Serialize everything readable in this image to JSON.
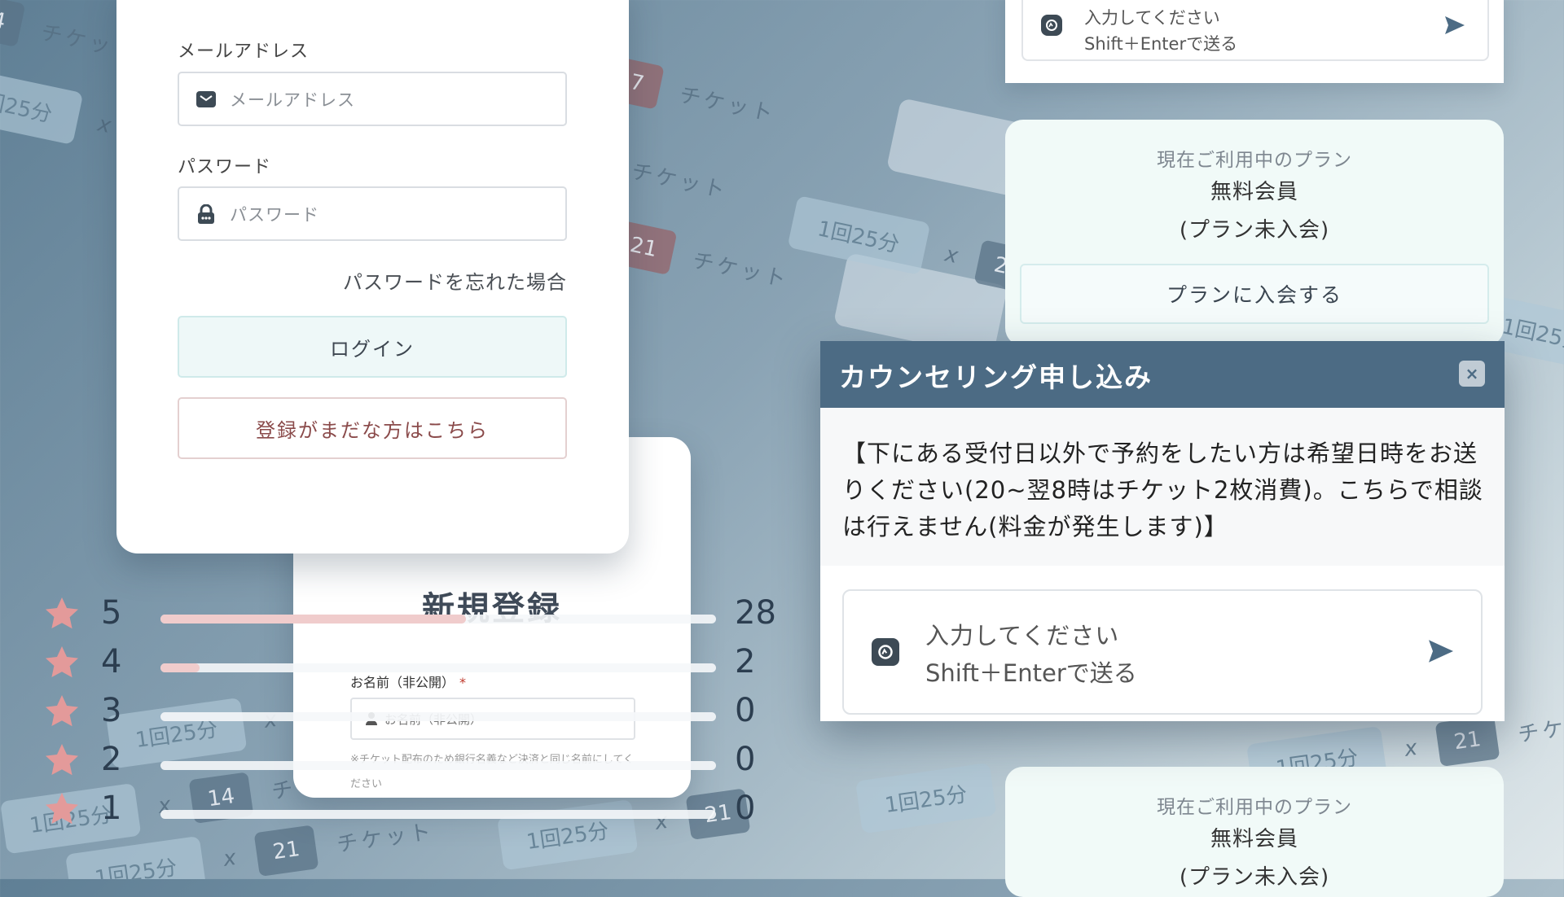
{
  "login": {
    "email_label": "メールアドレス",
    "email_placeholder": "メールアドレス",
    "password_label": "パスワード",
    "password_placeholder": "パスワード",
    "forgot_link": "パスワードを忘れた場合",
    "login_button": "ログイン",
    "register_button": "登録がまだな方はこちら"
  },
  "signup": {
    "title": "新規登録",
    "name_label": "お名前（非公開）",
    "required_mark": "*",
    "name_placeholder": "お名前（非公開）",
    "name_note": "※チケット配布のため銀行名義など決済と同じ名前にしてください"
  },
  "ratings": [
    {
      "stars": "5",
      "count": "28",
      "fill": 0.55
    },
    {
      "stars": "4",
      "count": "2",
      "fill": 0.07
    },
    {
      "stars": "3",
      "count": "0",
      "fill": 0
    },
    {
      "stars": "2",
      "count": "0",
      "fill": 0
    },
    {
      "stars": "1",
      "count": "0",
      "fill": 0
    }
  ],
  "chat_top": {
    "placeholder_line1": "入力してください",
    "placeholder_line2": "Shift＋Enterで送る"
  },
  "plan": {
    "current_label": "現在ご利用中のプラン",
    "plan_name": "無料会員",
    "plan_sub": "(プラン未入会)",
    "join_button": "プランに入会する"
  },
  "plan_bottom": {
    "current_label": "現在ご利用中のプラン",
    "plan_name": "無料会員",
    "plan_sub": "(プラン未入会)"
  },
  "modal": {
    "title": "カウンセリング申し込み",
    "close_label": "×",
    "message": "【下にある受付日以外で予約をしたい方は希望日時をお送りください(20~翌8時はチケット2枚消費)。こちらで相談は行えません(料金が発生します)】",
    "placeholder_line1": "入力してください",
    "placeholder_line2": "Shift＋Enterで送る"
  },
  "background_tickets": {
    "duration": "1回25分",
    "times": "x",
    "ticket_word": "チケット",
    "counts": [
      "7",
      "14",
      "21"
    ]
  },
  "colors": {
    "modal_header": "#4c6b84",
    "star": "#e39a9a",
    "register_text": "#8a4a4a",
    "login_button_bg": "#eef8f8"
  }
}
